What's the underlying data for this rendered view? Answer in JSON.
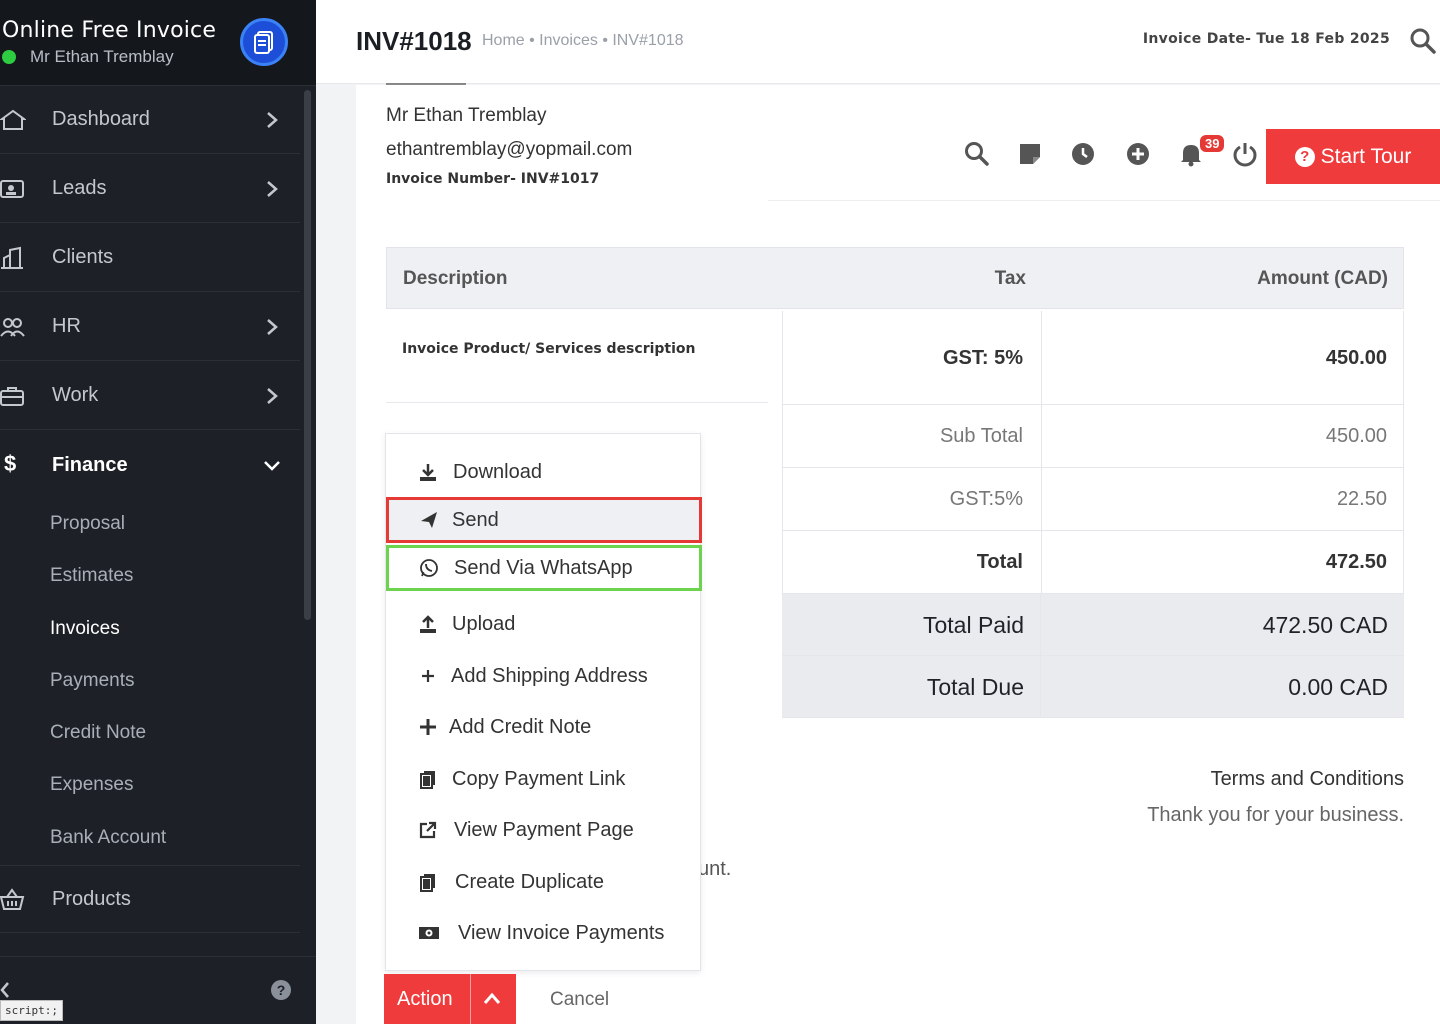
{
  "sidebar": {
    "app_name": "Online Free Invoice",
    "user_name": "Mr Ethan Tremblay",
    "menu": [
      {
        "label": "Dashboard"
      },
      {
        "label": "Leads"
      },
      {
        "label": "Clients"
      },
      {
        "label": "HR"
      },
      {
        "label": "Work"
      },
      {
        "label": "Finance"
      },
      {
        "label": "Products"
      }
    ],
    "finance_sub": [
      "Proposal",
      "Estimates",
      "Invoices",
      "Payments",
      "Credit Note",
      "Expenses",
      "Bank Account"
    ],
    "tooltip": "script:;"
  },
  "header": {
    "title": "INV#1018",
    "breadcrumb": "Home • Invoices • INV#1018",
    "invoice_date": "Invoice Date- Tue 18 Feb 2025"
  },
  "billing": {
    "name": "Mr Ethan Tremblay",
    "email": "ethantremblay@yopmail.com",
    "invoice_number": "Invoice Number- INV#1017"
  },
  "toolbar": {
    "notification_count": "39",
    "start_tour": "Start Tour"
  },
  "table": {
    "headers": {
      "description": "Description",
      "tax": "Tax",
      "amount": "Amount (CAD)"
    },
    "rows": [
      {
        "description": "Invoice Product/ Services description",
        "tax": "GST: 5%",
        "amount": "450.00"
      }
    ]
  },
  "summary": [
    {
      "label": "Sub Total",
      "value": "450.00"
    },
    {
      "label": "GST:5%",
      "value": "22.50"
    },
    {
      "label": "Total",
      "value": "472.50"
    },
    {
      "label": "Total Paid",
      "value": "472.50 CAD"
    },
    {
      "label": "Total Due",
      "value": "0.00 CAD"
    }
  ],
  "footer": {
    "terms": "Terms and Conditions",
    "thanks": "Thank you for your business.",
    "partial": "unt."
  },
  "action_menu": {
    "items": [
      {
        "label": "Download",
        "icon": "download-icon"
      },
      {
        "label": "Send",
        "icon": "paper-plane-icon"
      },
      {
        "label": "Send Via WhatsApp",
        "icon": "whatsapp-icon"
      },
      {
        "label": "Upload",
        "icon": "upload-icon"
      },
      {
        "label": "Add Shipping Address",
        "icon": "plus-icon"
      },
      {
        "label": "Add Credit Note",
        "icon": "plus-icon"
      },
      {
        "label": "Copy Payment Link",
        "icon": "copy-icon"
      },
      {
        "label": "View Payment Page",
        "icon": "external-link-icon"
      },
      {
        "label": "Create Duplicate",
        "icon": "copy-icon"
      },
      {
        "label": "View Invoice Payments",
        "icon": "money-icon"
      }
    ],
    "action_label": "Action",
    "cancel_label": "Cancel"
  },
  "colors": {
    "sidebar_bg": "#1d2127",
    "accent_red": "#ef3b3b",
    "highlight_red": "#e53935",
    "highlight_green": "#6dd34f",
    "online_green": "#2ecc40"
  }
}
